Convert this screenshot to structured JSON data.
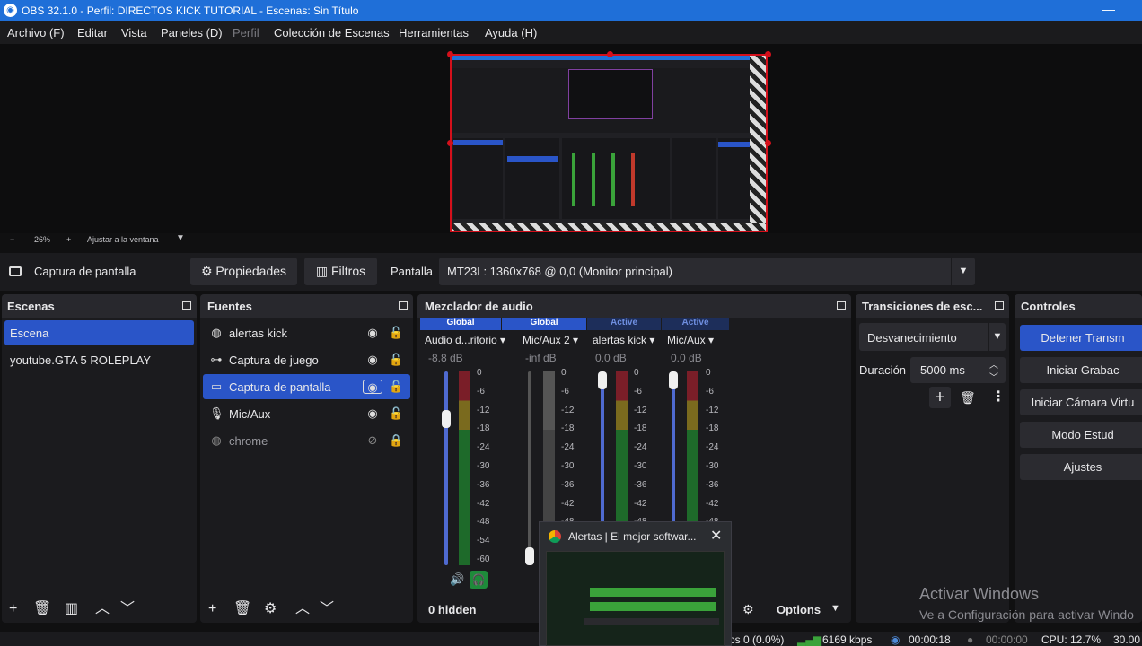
{
  "window": {
    "title": "OBS 32.1.0 - Perfil: DIRECTOS KICK TUTORIAL - Escenas: Sin Título"
  },
  "menu": [
    "Archivo (F)",
    "Editar",
    "Vista",
    "Paneles (D)",
    "Perfil",
    "Colección de Escenas",
    "Herramientas",
    "Ayuda (H)"
  ],
  "zoom": {
    "minus": "−",
    "value": "26%",
    "plus": "+",
    "fit": "Ajustar a la ventana"
  },
  "source_bar": {
    "name": "Captura de pantalla",
    "properties": "Propiedades",
    "filters": "Filtros",
    "display_label": "Pantalla",
    "display_value": "MT23L: 1360x768 @ 0,0 (Monitor principal)"
  },
  "scenes": {
    "title": "Escenas",
    "items": [
      "Escena",
      "youtube.GTA 5 ROLEPLAY"
    ]
  },
  "sources": {
    "title": "Fuentes",
    "items": [
      {
        "name": "alertas kick",
        "icon": "globe-icon"
      },
      {
        "name": "Captura de juego",
        "icon": "gamepad-icon"
      },
      {
        "name": "Captura de pantalla",
        "icon": "monitor-icon"
      },
      {
        "name": "Mic/Aux",
        "icon": "mic-icon"
      },
      {
        "name": "chrome",
        "icon": "globe-icon"
      }
    ]
  },
  "mixer": {
    "title": "Mezclador de audio",
    "channels": [
      {
        "tag": "Global",
        "name": "Audio d...ritorio",
        "db": "-8.8 dB",
        "level": 0.78
      },
      {
        "tag": "Global",
        "name": "Mic/Aux 2",
        "db": "-inf dB",
        "level": 0
      },
      {
        "tag": "Active",
        "name": "alertas kick",
        "db": "0.0 dB",
        "level": 1.0
      },
      {
        "tag": "Active",
        "name": "Mic/Aux",
        "db": "0.0 dB",
        "level": 1.0
      }
    ],
    "ticks": [
      "0",
      "-6",
      "-12",
      "-18",
      "-24",
      "-30",
      "-36",
      "-42",
      "-48",
      "-54",
      "-60"
    ],
    "hidden": "0 hidden",
    "options": "Options"
  },
  "transitions": {
    "title": "Transiciones de esc...",
    "value": "Desvanecimiento",
    "duration_label": "Duración",
    "duration_value": "5000 ms"
  },
  "controls": {
    "title": "Controles",
    "buttons": [
      "Detener Transm",
      "Iniciar Grabac",
      "Iniciar Cámara Virtu",
      "Modo Estud",
      "Ajustes"
    ]
  },
  "popup": {
    "title": "Alertas | El mejor softwar..."
  },
  "status": {
    "dropped": "os 0 (0.0%)",
    "kbps": "6169 kbps",
    "stream_time": "00:00:18",
    "rec_time": "00:00:00",
    "cpu": "CPU: 12.7%",
    "fps": "30.00"
  },
  "watermark": {
    "line1": "Activar Windows",
    "line2": "Ve a Configuración para activar Windo"
  }
}
